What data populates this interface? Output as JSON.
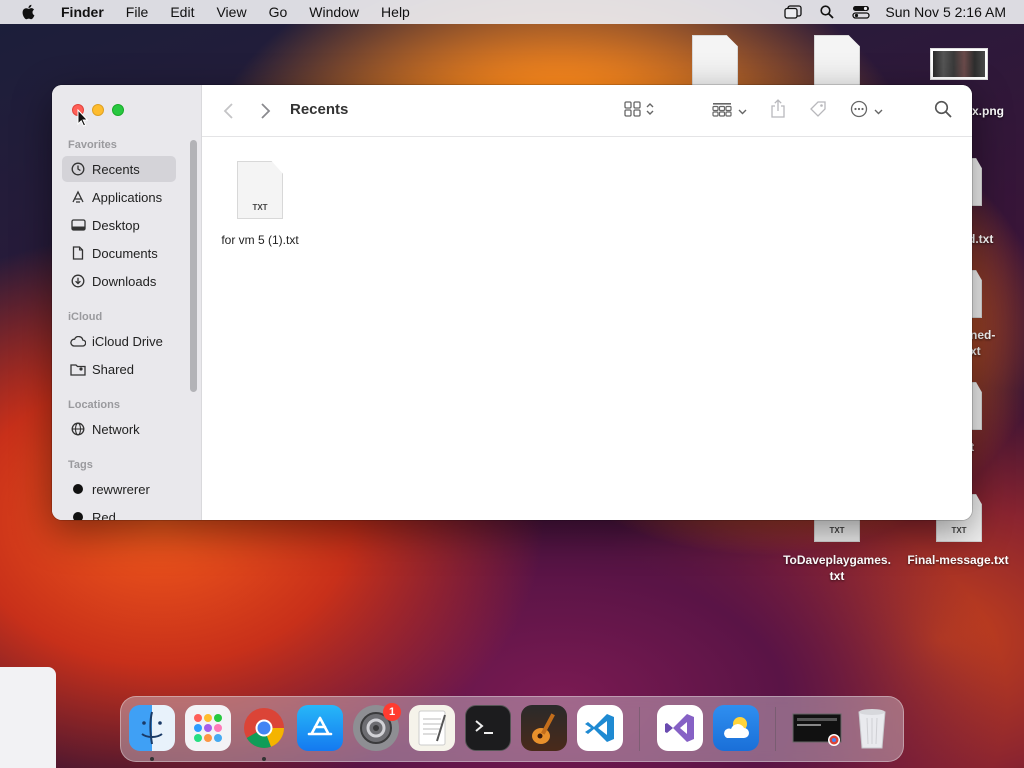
{
  "menubar": {
    "app_name": "Finder",
    "items": [
      "File",
      "Edit",
      "View",
      "Go",
      "Window",
      "Help"
    ],
    "clock": "Sun Nov 5  2:16 AM"
  },
  "desktop": {
    "icons": [
      {
        "label": "x.png"
      },
      {
        "label": "d.txt"
      },
      {
        "label": "ned-\nxt"
      },
      {
        "label": "t"
      },
      {
        "label": "ToDaveplaygames.\ntxt",
        "ext": "TXT"
      },
      {
        "label": "Final-message.txt",
        "ext": "TXT"
      }
    ]
  },
  "finder": {
    "title": "Recents",
    "sidebar": {
      "favorites_header": "Favorites",
      "favorites": [
        "Recents",
        "Applications",
        "Desktop",
        "Documents",
        "Downloads"
      ],
      "icloud_header": "iCloud",
      "icloud": [
        "iCloud Drive",
        "Shared"
      ],
      "locations_header": "Locations",
      "locations": [
        "Network"
      ],
      "tags_header": "Tags",
      "tags": [
        "rewwrerer",
        "Red"
      ]
    },
    "files": [
      {
        "name": "for vm 5 (1).txt",
        "ext": "TXT"
      }
    ]
  },
  "dock": {
    "apps": [
      "finder-icon",
      "launchpad-icon",
      "chrome-icon",
      "app-store-icon",
      "system-settings-icon",
      "textedit-icon",
      "terminal-icon",
      "garageband-icon",
      "vscode-icon",
      "visual-studio-icon",
      "weather-icon",
      "screen-recording-icon",
      "trash-icon"
    ],
    "settings_badge": "1"
  }
}
